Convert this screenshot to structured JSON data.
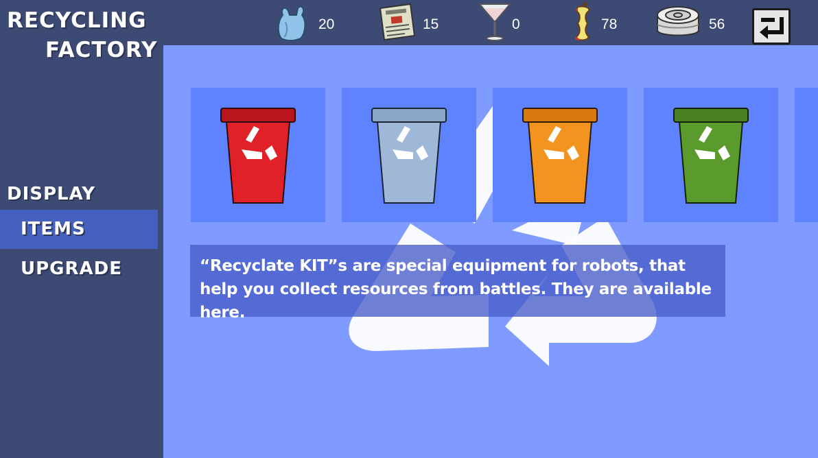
{
  "title": {
    "line1": "RECYCLING",
    "line2": "FACTORY"
  },
  "resources": [
    {
      "icon": "plastic-bag-icon",
      "value": "20"
    },
    {
      "icon": "newspaper-icon",
      "value": "15"
    },
    {
      "icon": "glass-icon",
      "value": "0"
    },
    {
      "icon": "apple-core-icon",
      "value": "78"
    },
    {
      "icon": "tin-can-icon",
      "value": "56"
    }
  ],
  "back_icon": "back-arrow-icon",
  "sidebar": {
    "heading": "DISPLAY",
    "items": [
      {
        "label": "ITEMS",
        "active": true
      },
      {
        "label": "UPGRADE",
        "active": false
      }
    ]
  },
  "bins": [
    {
      "name": "red-bin",
      "color": "#e02228"
    },
    {
      "name": "blue-bin",
      "color": "#9fb8d8"
    },
    {
      "name": "orange-bin",
      "color": "#f39420"
    },
    {
      "name": "green-bin",
      "color": "#5b9a2c"
    }
  ],
  "info_text": "“Recyclate KIT”s are special equipment for robots, that help you collect resources from battles. They are available here.",
  "colors": {
    "sidebar_bg": "#3d4a73",
    "main_bg": "#7f9bff",
    "tile_bg": "#5f83ff",
    "active_item": "#4660c0"
  }
}
